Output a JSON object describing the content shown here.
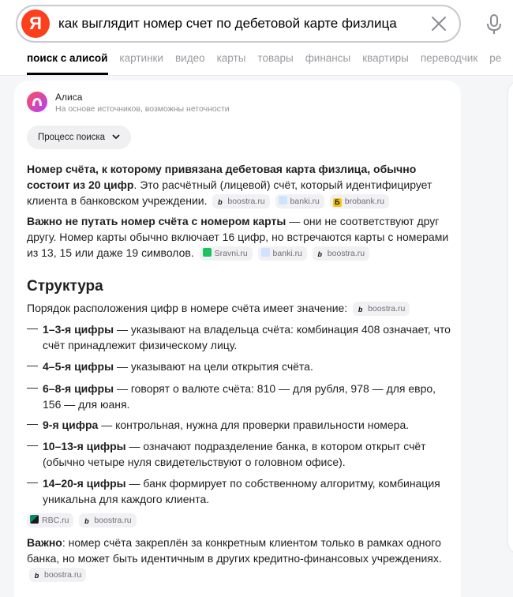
{
  "search": {
    "query": "как выглядит номер счет по дебетовой карте физлица",
    "logo_letter": "Я"
  },
  "tabs": [
    {
      "label": "поиск с алисой",
      "active": true
    },
    {
      "label": "картинки"
    },
    {
      "label": "видео"
    },
    {
      "label": "карты"
    },
    {
      "label": "товары"
    },
    {
      "label": "финансы"
    },
    {
      "label": "квартиры"
    },
    {
      "label": "переводчик"
    },
    {
      "label": "ре"
    }
  ],
  "answer": {
    "assistant_name": "Алиса",
    "assistant_sub": "На основе источников, возможны неточности",
    "process_button": "Процесс поиска",
    "p1": {
      "bold": "Номер счёта, к которому привязана дебетовая карта физлица, обычно состоит из 20 цифр",
      "text": ". Это расчётный (лицевой) счёт, который идентифицирует клиента в банковском учреждении.",
      "sources": [
        "boostra.ru",
        "banki.ru",
        "brobank.ru"
      ]
    },
    "p2": {
      "bold": "Важно не путать номер счёта с номером карты",
      "text": " — они не соответствуют друг другу. Номер карты обычно включает 16 цифр, но встречаются карты с номерами из 13, 15 или даже 19 символов.",
      "sources": [
        "Sravni.ru",
        "banki.ru",
        "boostra.ru"
      ]
    },
    "heading": "Структура",
    "intro": {
      "text": "Порядок расположения цифр в номере счёта имеет значение:",
      "sources": [
        "boostra.ru"
      ]
    },
    "items": [
      {
        "dash": "—",
        "bold": "1–3-я цифры",
        "text": " — указывают на владельца счёта: комбинация 408 означает, что счёт принадлежит физическому лицу."
      },
      {
        "dash": "—",
        "bold": "4–5-я цифры",
        "text": " — указывают на цели открытия счёта."
      },
      {
        "dash": "—",
        "bold": "6–8-я цифры",
        "text": " — говорят о валюте счёта: 810 — для рубля, 978 — для евро, 156 — для юаня."
      },
      {
        "dash": "—",
        "bold": "9-я цифра",
        "text": " — контрольная, нужна для проверки правильности номера."
      },
      {
        "dash": "—",
        "bold": "10–13-я цифры",
        "text": " — означают подразделение банка, в котором открыт счёт (обычно четыре нуля свидетельствуют о головном офисе)."
      },
      {
        "dash": "—",
        "bold": "14–20-я цифры",
        "text": " — банк формирует по собственному алгоритму, комбинация уникальна для каждого клиента."
      }
    ],
    "list_sources": [
      "RBC.ru",
      "boostra.ru"
    ],
    "p3": {
      "bold": "Важно",
      "text": ": номер счёта закреплён за конкретным клиентом только в рамках одного банка, но может быть идентичным в других кредитно-финансовых учреждениях.",
      "sources": [
        "boostra.ru"
      ]
    }
  },
  "colors": {
    "yandex_red": "#fc3f1d",
    "alice_gradient": [
      "#ff4f5a",
      "#b040ff"
    ],
    "tab_active": "#000000",
    "tab_inactive": "#9a9ba1"
  }
}
